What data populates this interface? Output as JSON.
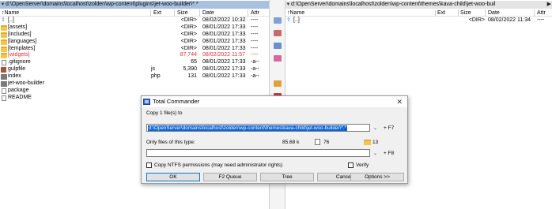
{
  "left_panel": {
    "path": "d:\\OpenServer\\domains\\localhost\\zolden\\wp-content\\plugins\\jet-woo-builder\\*.*",
    "columns": [
      "↑Name",
      "Ext",
      "Size",
      "Date",
      "Attr"
    ],
    "rows": [
      {
        "name": "[..]",
        "ext": "",
        "size": "<DIR>",
        "date": "08/02/2022 10:32",
        "attr": "----",
        "icon": "up-icon",
        "red": false
      },
      {
        "name": "[assets]",
        "ext": "",
        "size": "<DIR>",
        "date": "08/01/2022 17:33",
        "attr": "----",
        "icon": "folder-icon",
        "red": false
      },
      {
        "name": "[includes]",
        "ext": "",
        "size": "<DIR>",
        "date": "08/01/2022 17:33",
        "attr": "----",
        "icon": "folder-icon",
        "red": false
      },
      {
        "name": "[languages]",
        "ext": "",
        "size": "<DIR>",
        "date": "08/01/2022 17:33",
        "attr": "----",
        "icon": "folder-icon",
        "red": false
      },
      {
        "name": "[templates]",
        "ext": "",
        "size": "<DIR>",
        "date": "08/01/2022 17:33",
        "attr": "----",
        "icon": "folder-icon",
        "red": false
      },
      {
        "name": "[widgets]",
        "ext": "",
        "size": "87,744",
        "date": "08/02/2022 11:57",
        "attr": "----",
        "icon": "folder-icon",
        "red": true
      },
      {
        "name": ".gitignore",
        "ext": "",
        "size": "65",
        "date": "08/01/2022 17:33",
        "attr": "-a--",
        "icon": "file-icon",
        "red": false
      },
      {
        "name": "gulpfile",
        "ext": "js",
        "size": "5,390",
        "date": "08/01/2022 17:33",
        "attr": "-a--",
        "icon": "gulp-file-icon",
        "red": false
      },
      {
        "name": "index",
        "ext": "php",
        "size": "131",
        "date": "08/01/2022 17:33",
        "attr": "-a--",
        "icon": "php-file-icon",
        "red": false
      },
      {
        "name": "jet-woo-builder",
        "ext": "",
        "size": "",
        "date": "",
        "attr": "",
        "icon": "php-file-icon",
        "red": false
      },
      {
        "name": "package",
        "ext": "",
        "size": "",
        "date": "",
        "attr": "",
        "icon": "file-icon",
        "red": false
      },
      {
        "name": "README",
        "ext": "",
        "size": "",
        "date": "",
        "attr": "",
        "icon": "file-icon",
        "red": false
      }
    ]
  },
  "right_panel": {
    "path": "d:\\OpenServer\\domains\\localhost\\zolden\\wp-content\\themes\\kava-child\\jet-woo-buil",
    "columns": [
      "↑Name",
      "Ext",
      "Size",
      "Date",
      "Attr"
    ],
    "rows": [
      {
        "name": "[..]",
        "ext": "",
        "size": "<DIR>",
        "date": "08/02/2022 11:34",
        "attr": "----",
        "icon": "up-icon"
      }
    ]
  },
  "dialog": {
    "title": "Total Commander",
    "close": "✕",
    "copy_label": "Copy 1 file(s) to",
    "destination": "d:\\OpenServer\\domains\\localhost\\zolden\\wp-content\\themes\\kava-child\\jet-woo-builder\\*.*",
    "f7": "F7",
    "filter_label": "Only files of this type:",
    "size_info": "85.68 k",
    "files_count": "76",
    "folders_count": "13",
    "f8": "F8",
    "ntfs_label": "Copy NTFS permissions (may need administrator rights)",
    "verify_label": "Verify",
    "buttons": {
      "ok": "OK",
      "queue": "F2 Queue",
      "tree": "Tree",
      "cancel": "Cancel",
      "options": "Options >>"
    }
  }
}
